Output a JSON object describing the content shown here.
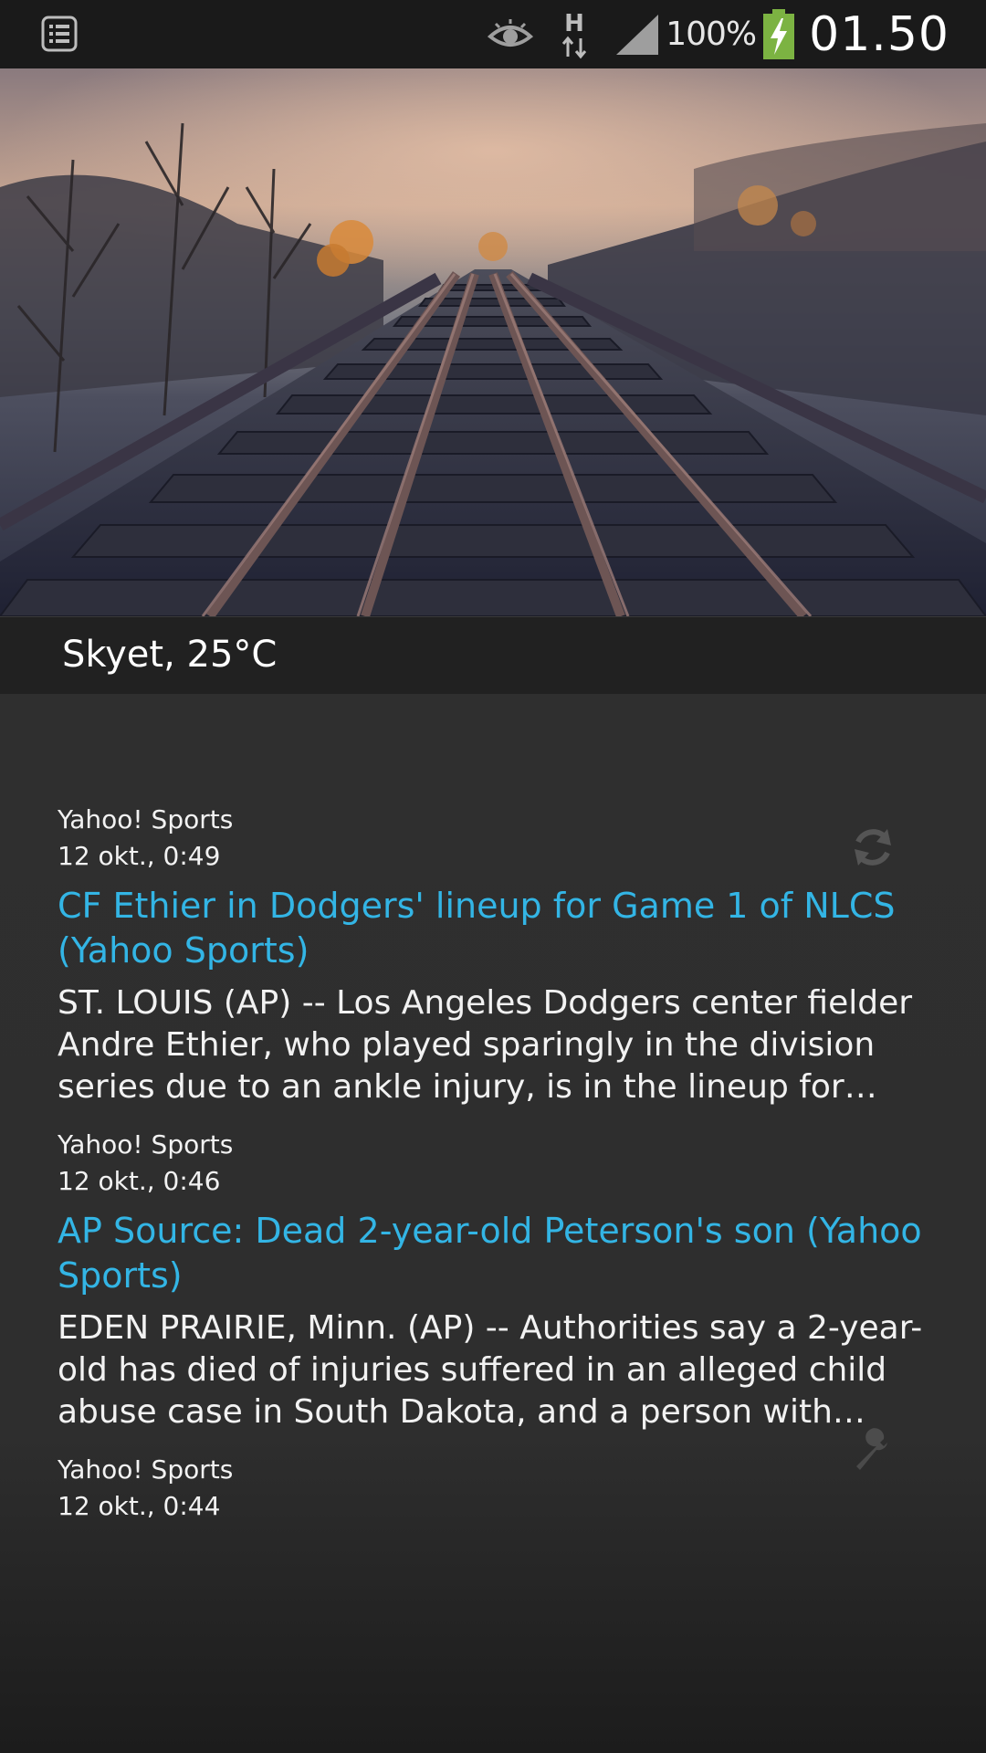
{
  "status_bar": {
    "battery_percent": "100%",
    "clock": "01.50",
    "icons": [
      "notification-list-icon",
      "eye-icon",
      "hspa-data-icon",
      "signal-icon",
      "battery-charging-icon"
    ]
  },
  "weather": {
    "text": "Skyet, 25°C"
  },
  "feed": {
    "items": [
      {
        "source": "Yahoo! Sports",
        "time": "12 okt., 0:49",
        "headline": "CF Ethier in Dodgers' lineup for Game 1 of NLCS (Yahoo Sports)",
        "summary": "ST. LOUIS (AP) -- Los Angeles Dodgers center fielder Andre Ethier, who played sparingly in the division series due to an ankle injury, is in the lineup for Game…"
      },
      {
        "source": "Yahoo! Sports",
        "time": "12 okt., 0:46",
        "headline": "AP Source: Dead 2-year-old Peterson's son (Yahoo Sports)",
        "summary": "EDEN PRAIRIE, Minn. (AP) -- Authorities say a 2-year-old has died of injuries suffered in an alleged child abuse case in South Dakota, and a person with…"
      },
      {
        "source": "Yahoo! Sports",
        "time": "12 okt., 0:44"
      }
    ]
  },
  "colors": {
    "accent": "#33b5e5",
    "status_bar_bg": "#1a1a1a",
    "weather_bar_bg": "#212121",
    "feed_bg": "#2e2e2e"
  }
}
